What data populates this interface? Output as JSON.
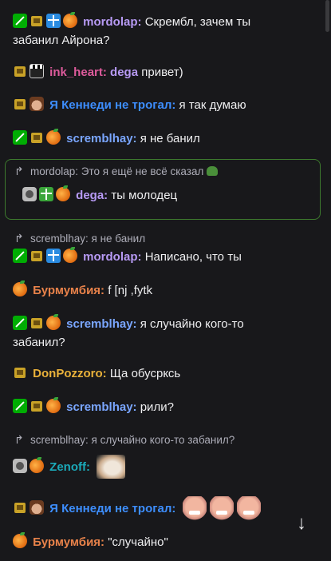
{
  "colors": {
    "mod": "#00ad03",
    "vip": "#c9a227",
    "reply_border": "#3d7a2e",
    "mordolap": "#b79af4",
    "ink_heart": "#de5b9c",
    "dega": "#b79af4",
    "kennedy": "#3d8eff",
    "screm": "#7aa6ff",
    "burm": "#e8824a",
    "donpozzoro": "#e9b13a",
    "zenoff": "#1ba9b9"
  },
  "messages": [
    {
      "user": "mordolap:",
      "text": "Скрембл, зачем ты",
      "text2": "забанил Айрона?"
    },
    {
      "user": "ink_heart:",
      "mention": "dega",
      "text": "привет)"
    },
    {
      "user": "Я Кеннеди не трогал:",
      "text": "я так думаю"
    },
    {
      "user": "scremblhay:",
      "text": "я не банил"
    },
    {
      "reply": "mordolap: Это я ещё не всё сказал",
      "user": "dega:",
      "text": "ты молодец"
    },
    {
      "reply": "scremblhay: я не банил",
      "user": "mordolap:",
      "text": "Написано, что ты"
    },
    {
      "user": "Бурмумбия:",
      "text": "f [nj ,fytk"
    },
    {
      "user": "scremblhay:",
      "text": "я случайно кого-то",
      "text2": "забанил?"
    },
    {
      "user": "DonPozzoro:",
      "text": "Ща обусркcь"
    },
    {
      "user": "scremblhay:",
      "text": "рили?"
    },
    {
      "reply": "scremblhay: я случайно кого-то забанил?",
      "user": "Zenoff:"
    },
    {
      "user": "Я Кеннеди не трогал:"
    },
    {
      "user": "Бурмумбия:",
      "text": "\"случайно\""
    }
  ],
  "icons": {
    "reply": "reply-arrow-icon",
    "scroll": "arrow-down-icon"
  }
}
